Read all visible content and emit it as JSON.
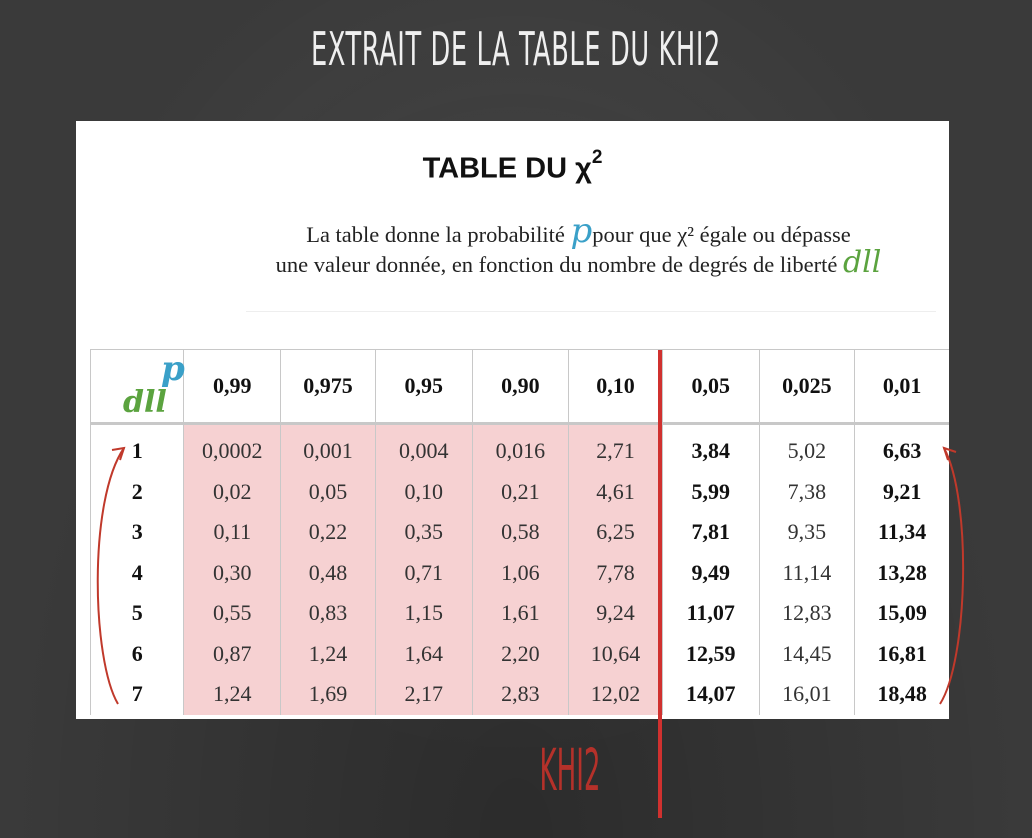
{
  "slide_title": "EXTRAIT DE LA TABLE DU KHI2",
  "table_title": {
    "text": "TABLE  DU  χ",
    "sup": "2"
  },
  "description": {
    "line1_before": "La table donne la probabilité ",
    "line1_p": "p",
    "line1_after": "pour que χ² égale ou dépasse",
    "line2_text": "une valeur donnée, en fonction du nombre de degrés de liberté ",
    "line2_ddl": "dll"
  },
  "corner": {
    "p": "p",
    "ddl": "dll"
  },
  "columns": [
    "0,99",
    "0,975",
    "0,95",
    "0,90",
    "0,10",
    "0,05",
    "0,025",
    "0,01"
  ],
  "rows": [
    {
      "ddl": "1",
      "values": [
        "0,0002",
        "0,001",
        "0,004",
        "0,016",
        "2,71",
        "3,84",
        "5,02",
        "6,63"
      ]
    },
    {
      "ddl": "2",
      "values": [
        "0,02",
        "0,05",
        "0,10",
        "0,21",
        "4,61",
        "5,99",
        "7,38",
        "9,21"
      ]
    },
    {
      "ddl": "3",
      "values": [
        "0,11",
        "0,22",
        "0,35",
        "0,58",
        "6,25",
        "7,81",
        "9,35",
        "11,34"
      ]
    },
    {
      "ddl": "4",
      "values": [
        "0,30",
        "0,48",
        "0,71",
        "1,06",
        "7,78",
        "9,49",
        "11,14",
        "13,28"
      ]
    },
    {
      "ddl": "5",
      "values": [
        "0,55",
        "0,83",
        "1,15",
        "1,61",
        "9,24",
        "11,07",
        "12,83",
        "15,09"
      ]
    },
    {
      "ddl": "6",
      "values": [
        "0,87",
        "1,24",
        "1,64",
        "2,20",
        "10,64",
        "12,59",
        "14,45",
        "16,81"
      ]
    },
    {
      "ddl": "7",
      "values": [
        "1,24",
        "1,69",
        "2,17",
        "2,83",
        "12,02",
        "14,07",
        "16,01",
        "18,48"
      ]
    }
  ],
  "khi2_label": "KHI2",
  "colors": {
    "pink_highlight": "#f6d1d2",
    "red_line": "#d0312f",
    "p_blue": "#3aa0c8",
    "ddl_green": "#5ba33f"
  }
}
